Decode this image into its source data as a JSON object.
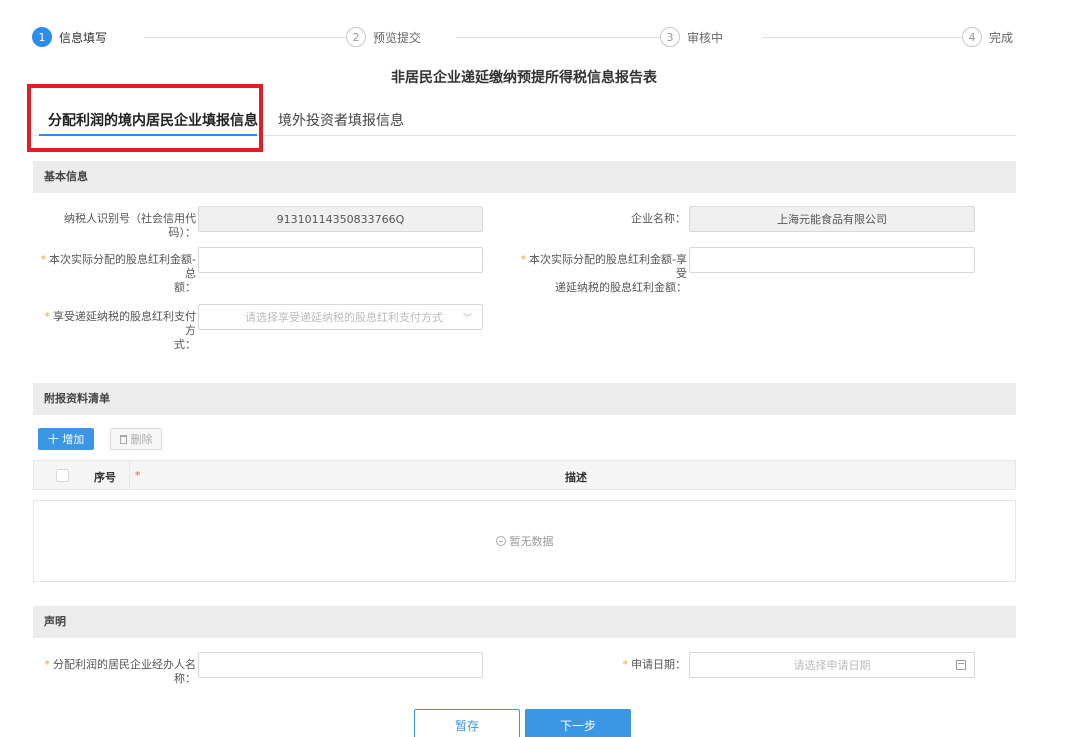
{
  "steps": [
    {
      "num": "1",
      "label": "信息填写"
    },
    {
      "num": "2",
      "label": "预览提交"
    },
    {
      "num": "3",
      "label": "审核中"
    },
    {
      "num": "4",
      "label": "完成"
    }
  ],
  "title": "非居民企业递延缴纳预提所得税信息报告表",
  "tabs": [
    {
      "label": "分配利润的境内居民企业填报信息"
    },
    {
      "label": "境外投资者填报信息"
    }
  ],
  "basic": {
    "header": "基本信息",
    "taxpayer_id": {
      "label": "纳税人识别号（社会信用代码）：",
      "value": "91310114350833766Q"
    },
    "company_name": {
      "label": "企业名称：",
      "value": "上海元能食品有限公司"
    },
    "total_amount": {
      "label_1": "本次实际分配的股息红利金额-总",
      "label_2": "额：",
      "value": ""
    },
    "deferred_amount": {
      "label_1": "本次实际分配的股息红利金额-享受",
      "label_2": "递延纳税的股息红利金额：",
      "value": ""
    },
    "payment_method": {
      "label_1": "享受递延纳税的股息红利支付方",
      "label_2": "式：",
      "placeholder": "请选择享受递延纳税的股息红利支付方式"
    }
  },
  "attachments": {
    "header": "附报资料清单",
    "add_label": "十 增加",
    "delete_label": "删除",
    "col_no": "序号",
    "col_required": "*",
    "col_desc": "描述",
    "empty_text": "暂无数据"
  },
  "declaration": {
    "header": "声明",
    "handler": {
      "label": "分配利润的居民企业经办人名称：",
      "value": ""
    },
    "apply_date": {
      "label": "申请日期：",
      "placeholder": "请选择申请日期"
    }
  },
  "buttons": {
    "save": "暂存",
    "next": "下一步"
  },
  "colors": {
    "primary": "#3a97e6",
    "highlight": "#e51c23",
    "required": "#f5a623"
  }
}
